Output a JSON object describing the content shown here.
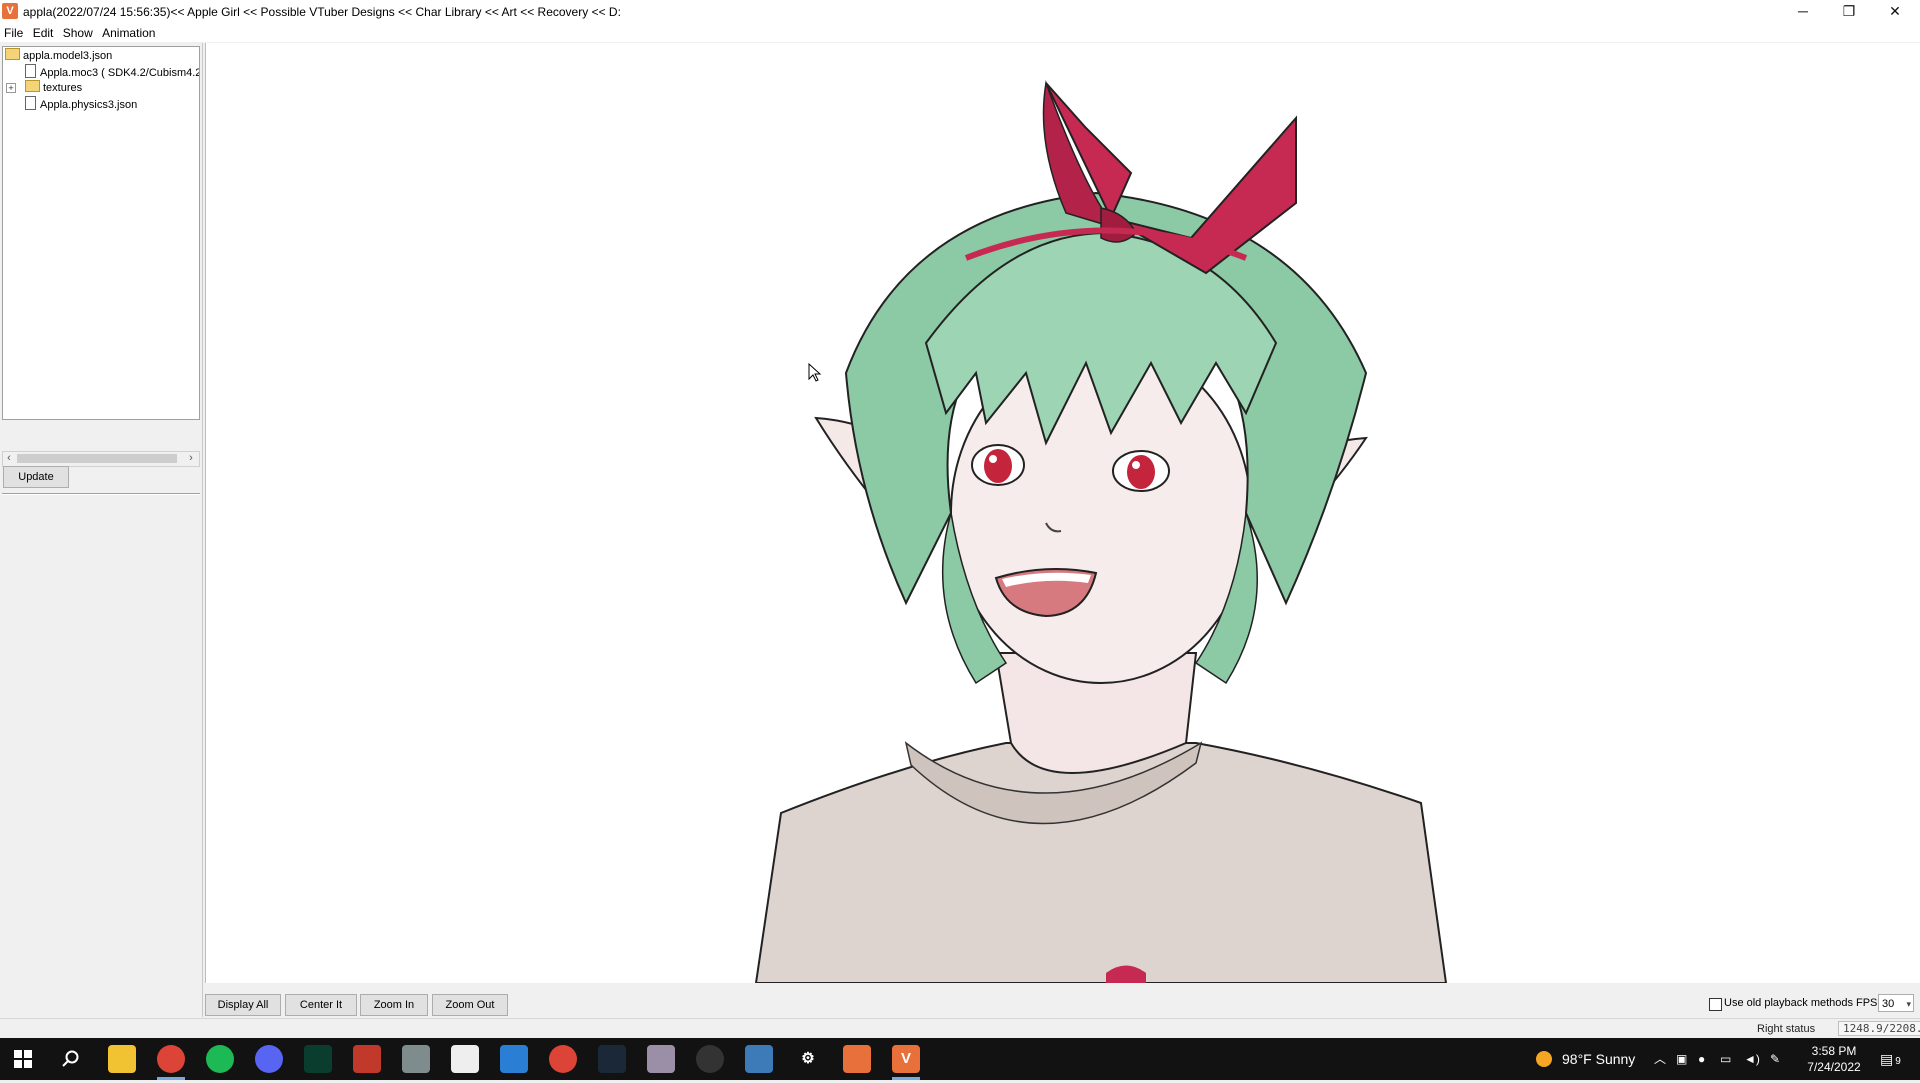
{
  "window": {
    "title": "appla(2022/07/24 15:56:35)<< Apple Girl << Possible VTuber Designs << Char Library << Art << Recovery << D:",
    "app_icon": "v-app-icon",
    "controls": {
      "minimize": "─",
      "restore": "❐",
      "close": "✕"
    }
  },
  "menu": {
    "file": "File",
    "edit": "Edit",
    "show": "Show",
    "animation": "Animation"
  },
  "tree": {
    "root": "appla.model3.json",
    "items": [
      {
        "label": "Appla.moc3 ( SDK4.2/Cubism4.2",
        "icon": "file-icon"
      },
      {
        "label": "textures",
        "icon": "folder-icon",
        "expander": "+"
      },
      {
        "label": "Appla.physics3.json",
        "icon": "file-icon"
      }
    ]
  },
  "scroll": {
    "left": "‹",
    "right": "›"
  },
  "buttons": {
    "update": "Update"
  },
  "toolbar": {
    "display_all": "Display All",
    "center_it": "Center It",
    "zoom_in": "Zoom In",
    "zoom_out": "Zoom Out"
  },
  "playback": {
    "old_methods_label": "Use old playback methods",
    "old_methods_checked": false,
    "fps_label": "FPS",
    "fps_value": "30"
  },
  "status": {
    "right": "Right status",
    "coordinates": "1248.9/2208."
  },
  "taskbar": {
    "icons": [
      "windows-start-icon",
      "search-icon",
      "file-explorer-icon",
      "chrome-icon",
      "spotify-icon",
      "discord-icon",
      "terminal-icon",
      "app-icon",
      "app-icon",
      "app-icon",
      "photos-icon",
      "chrome-icon",
      "steam-icon",
      "app-icon",
      "obs-icon",
      "calculator-icon",
      "settings-icon",
      "app-icon",
      "viewer-icon"
    ],
    "weather": "98°F  Sunny",
    "time": "3:58 PM",
    "date": "7/24/2022",
    "notification_count": "9"
  },
  "colors": {
    "ribbon": "#c62a52",
    "hair": "#8cc9a5",
    "eyes": "#c4243c",
    "skin": "#f7ecec",
    "sweater": "#ddd3cf",
    "accent": "#e8703a"
  }
}
